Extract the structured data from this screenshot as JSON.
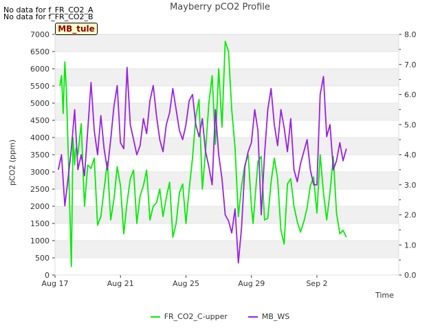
{
  "header": {
    "nodata_lines": [
      "No data for f_FR_CO2_A",
      "No data for f_FR_CO2_B"
    ],
    "site_badge": "MB_tule"
  },
  "chart_data": {
    "type": "line",
    "title": "Mayberry pCO2 Profile",
    "xlabel": "Time",
    "ylabel": "pCO2 (ppm)",
    "ylim": [
      0,
      7000
    ],
    "y2lim": [
      0.0,
      8.0
    ],
    "xlim_days": [
      0,
      21
    ],
    "x_start_label": "Aug 17",
    "x_ticks": [
      {
        "day": 0,
        "label": "Aug 17"
      },
      {
        "day": 4,
        "label": "Aug 21"
      },
      {
        "day": 8,
        "label": "Aug 25"
      },
      {
        "day": 12,
        "label": "Aug 29"
      },
      {
        "day": 16,
        "label": "Sep 2"
      }
    ],
    "y_ticks": [
      "0",
      "500",
      "1000",
      "1500",
      "2000",
      "2500",
      "3000",
      "3500",
      "4000",
      "4500",
      "5000",
      "5500",
      "6000",
      "6500",
      "7000"
    ],
    "y2_ticks": [
      "0.0",
      "1.0",
      "2.0",
      "3.0",
      "4.0",
      "5.0",
      "6.0",
      "7.0",
      "8.0"
    ],
    "grid": true,
    "legend_position": "bottom",
    "colors": {
      "fr_co2": "#00ee00",
      "mb_ws": "#9a1ee6",
      "band": "#f0f0f0"
    },
    "series": [
      {
        "name": "FR_CO2_C-upper",
        "axis": "left",
        "x": [
          0.3,
          0.4,
          0.5,
          0.6,
          0.7,
          0.8,
          0.9,
          1.0,
          1.1,
          1.2,
          1.25,
          1.3,
          1.4,
          1.6,
          1.8,
          2.0,
          2.2,
          2.4,
          2.6,
          2.8,
          3.0,
          3.2,
          3.4,
          3.6,
          3.8,
          4.0,
          4.2,
          4.4,
          4.6,
          4.8,
          5.0,
          5.2,
          5.4,
          5.6,
          5.8,
          6.0,
          6.2,
          6.4,
          6.6,
          6.8,
          7.0,
          7.2,
          7.4,
          7.6,
          7.8,
          8.0,
          8.2,
          8.4,
          8.6,
          8.8,
          9.0,
          9.2,
          9.4,
          9.6,
          9.8,
          10.0,
          10.2,
          10.4,
          10.6,
          10.8,
          11.0,
          11.2,
          11.4,
          11.6,
          11.8,
          12.0,
          12.1,
          12.2,
          12.4,
          12.6,
          12.8,
          13.0,
          13.2,
          13.4,
          13.6,
          13.8,
          14.0,
          14.2,
          14.4,
          14.6,
          14.8,
          15.0,
          15.2,
          15.4,
          15.6,
          15.8,
          16.0,
          16.2,
          16.4,
          16.6,
          16.8,
          17.0,
          17.2,
          17.4,
          17.6,
          17.8
        ],
        "y": [
          5500,
          5800,
          4700,
          6200,
          5300,
          3700,
          2000,
          250,
          4000,
          3200,
          3600,
          3700,
          3500,
          4400,
          2000,
          3200,
          3100,
          3400,
          1450,
          1700,
          2500,
          3300,
          1600,
          2200,
          3150,
          2600,
          1200,
          2100,
          2800,
          3050,
          1500,
          2300,
          2600,
          3050,
          1600,
          2000,
          2100,
          2500,
          1700,
          2250,
          2700,
          1100,
          1500,
          2400,
          2650,
          1500,
          2500,
          3400,
          4600,
          5100,
          2500,
          3600,
          5000,
          5800,
          3800,
          6000,
          4300,
          6800,
          6500,
          4800,
          3700,
          1700,
          2600,
          3200,
          3500,
          2000,
          1500,
          2100,
          3300,
          3450,
          1600,
          1650,
          2700,
          3400,
          2800,
          1300,
          900,
          2650,
          2800,
          2000,
          1550,
          1250,
          1550,
          1950,
          2600,
          2850,
          1800,
          3500,
          2400,
          1600,
          2400,
          3450,
          1800,
          1200,
          1300,
          1100
        ]
      },
      {
        "name": "MB_WS",
        "axis": "right",
        "x": [
          0.2,
          0.4,
          0.6,
          0.8,
          1.0,
          1.2,
          1.4,
          1.6,
          1.8,
          2.0,
          2.2,
          2.4,
          2.6,
          2.8,
          3.0,
          3.2,
          3.4,
          3.6,
          3.8,
          4.0,
          4.2,
          4.4,
          4.6,
          4.8,
          5.0,
          5.2,
          5.4,
          5.6,
          5.8,
          6.0,
          6.2,
          6.4,
          6.6,
          6.8,
          7.0,
          7.2,
          7.4,
          7.6,
          7.8,
          8.0,
          8.2,
          8.4,
          8.6,
          8.8,
          9.0,
          9.2,
          9.4,
          9.6,
          9.8,
          10.0,
          10.2,
          10.4,
          10.6,
          10.8,
          11.0,
          11.2,
          11.4,
          11.6,
          11.8,
          12.0,
          12.2,
          12.4,
          12.6,
          12.8,
          13.0,
          13.2,
          13.4,
          13.6,
          13.8,
          14.0,
          14.2,
          14.4,
          14.6,
          14.8,
          15.0,
          15.2,
          15.4,
          15.6,
          15.8,
          16.0,
          16.2,
          16.4,
          16.6,
          16.8,
          17.0,
          17.2,
          17.4,
          17.6,
          17.8
        ],
        "y": [
          3.5,
          4.0,
          2.3,
          3.2,
          4.2,
          5.5,
          3.5,
          4.0,
          3.3,
          4.8,
          6.4,
          4.8,
          4.0,
          5.3,
          4.2,
          3.5,
          4.5,
          5.6,
          6.3,
          4.4,
          4.2,
          6.9,
          5.0,
          4.5,
          4.0,
          4.3,
          5.2,
          4.7,
          5.8,
          6.3,
          5.3,
          4.5,
          4.1,
          5.0,
          5.4,
          6.2,
          5.5,
          4.8,
          4.5,
          5.0,
          5.8,
          6.0,
          5.0,
          4.6,
          5.2,
          4.1,
          3.6,
          3.0,
          5.5,
          4.0,
          3.2,
          2.0,
          1.8,
          1.4,
          2.2,
          0.4,
          1.6,
          3.6,
          4.1,
          4.4,
          5.5,
          4.8,
          2.0,
          4.0,
          5.5,
          6.2,
          5.0,
          4.3,
          5.5,
          4.9,
          4.1,
          5.2,
          3.5,
          3.1,
          3.7,
          4.1,
          4.5,
          3.5,
          3.0,
          3.0,
          6.0,
          6.6,
          4.6,
          5.0,
          3.5,
          3.8,
          4.4,
          3.8,
          4.2
        ]
      }
    ]
  }
}
